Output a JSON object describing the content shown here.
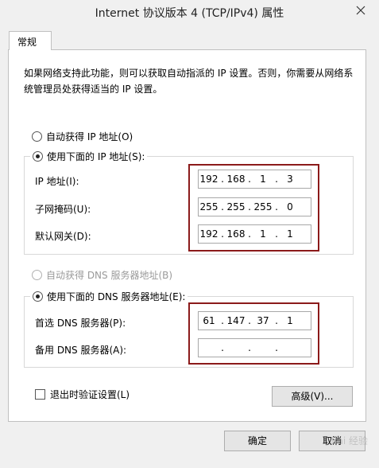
{
  "window": {
    "title": "Internet 协议版本 4 (TCP/IPv4) 属性",
    "close_icon": "close-icon"
  },
  "tab": {
    "label": "常规"
  },
  "description": "如果网络支持此功能，则可以获取自动指派的 IP 设置。否则，你需要从网络系统管理员处获得适当的 IP 设置。",
  "ip_section": {
    "auto_label": "自动获得 IP 地址(O)",
    "auto_checked": false,
    "manual_label": "使用下面的 IP 地址(S):",
    "manual_checked": true,
    "fields": [
      {
        "label": "IP 地址(I):",
        "octets": [
          "192",
          "168",
          "1",
          "3"
        ]
      },
      {
        "label": "子网掩码(U):",
        "octets": [
          "255",
          "255",
          "255",
          "0"
        ]
      },
      {
        "label": "默认网关(D):",
        "octets": [
          "192",
          "168",
          "1",
          "1"
        ]
      }
    ]
  },
  "dns_section": {
    "auto_label": "自动获得 DNS 服务器地址(B)",
    "auto_checked": false,
    "auto_disabled": true,
    "manual_label": "使用下面的 DNS 服务器地址(E):",
    "manual_checked": true,
    "fields": [
      {
        "label": "首选 DNS 服务器(P):",
        "octets": [
          "61",
          "147",
          "37",
          "1"
        ]
      },
      {
        "label": "备用 DNS 服务器(A):",
        "octets": [
          "",
          "",
          "",
          ""
        ]
      }
    ]
  },
  "validate": {
    "label": "退出时验证设置(L)",
    "checked": false
  },
  "buttons": {
    "advanced": "高级(V)...",
    "ok": "确定",
    "cancel": "取消"
  },
  "watermark": "Bai 经验",
  "highlight_color": "#8b1a1a"
}
